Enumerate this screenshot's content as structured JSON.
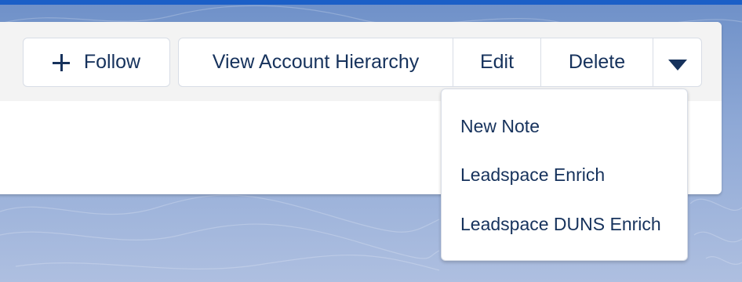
{
  "header": {
    "follow_label": "Follow"
  },
  "actions": {
    "view_hierarchy_label": "View Account Hierarchy",
    "edit_label": "Edit",
    "delete_label": "Delete"
  },
  "menu": {
    "items": [
      {
        "label": "New Note"
      },
      {
        "label": "Leadspace Enrich"
      },
      {
        "label": "Leadspace DUNS Enrich"
      }
    ]
  },
  "icons": {
    "follow": "plus-icon",
    "more": "chevron-down-icon"
  },
  "colors": {
    "text": "#16325c",
    "border": "#d8dde6",
    "header_bg": "#f3f3f3",
    "accent_bar": "#1b5fc7"
  }
}
